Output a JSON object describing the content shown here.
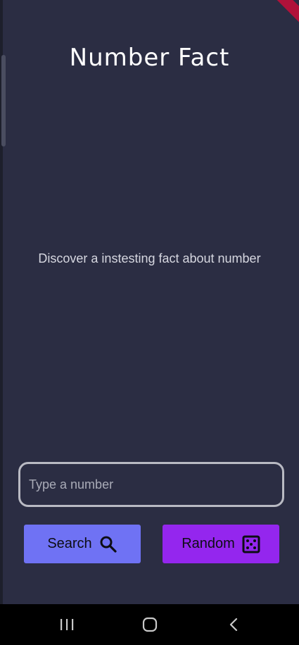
{
  "app": {
    "title": "Number Fact",
    "subtitle": "Discover a instesting fact about number"
  },
  "input": {
    "placeholder": "Type a number",
    "value": ""
  },
  "buttons": {
    "search_label": "Search",
    "search_icon": "search-icon",
    "random_label": "Random",
    "random_icon": "dice-icon"
  },
  "navbar": {
    "recents_icon": "recents-icon",
    "home_icon": "home-icon",
    "back_icon": "back-icon"
  },
  "colors": {
    "background": "#2b2d43",
    "search_button": "#6f72f4",
    "random_button": "#9426ee",
    "navbar": "#000000"
  }
}
